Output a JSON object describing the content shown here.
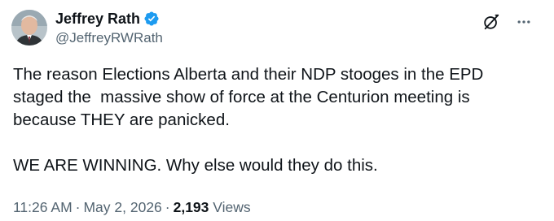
{
  "author": {
    "display_name": "Jeffrey Rath",
    "handle": "@JeffreyRWRath",
    "verified": true,
    "avatar_icon": "profile-photo-avatar"
  },
  "header_actions": {
    "grok_icon": "grok-icon",
    "more_icon": "more-horizontal-icon"
  },
  "tweet": {
    "text_line_1": "The reason Elections Alberta and their NDP stooges in the EPD",
    "text_line_2": "staged the  massive show of force at the Centurion meeting is",
    "text_line_3": "because THEY are panicked.",
    "text_line_4": "WE ARE WINNING. Why else would they do this."
  },
  "meta": {
    "time": "11:26 AM",
    "separator": "·",
    "date": "May 2, 2026",
    "views_count": "2,193",
    "views_label": "Views"
  },
  "colors": {
    "text_primary": "#0f1419",
    "text_secondary": "#536471",
    "verified_blue": "#1d9bf0",
    "background": "#ffffff"
  }
}
